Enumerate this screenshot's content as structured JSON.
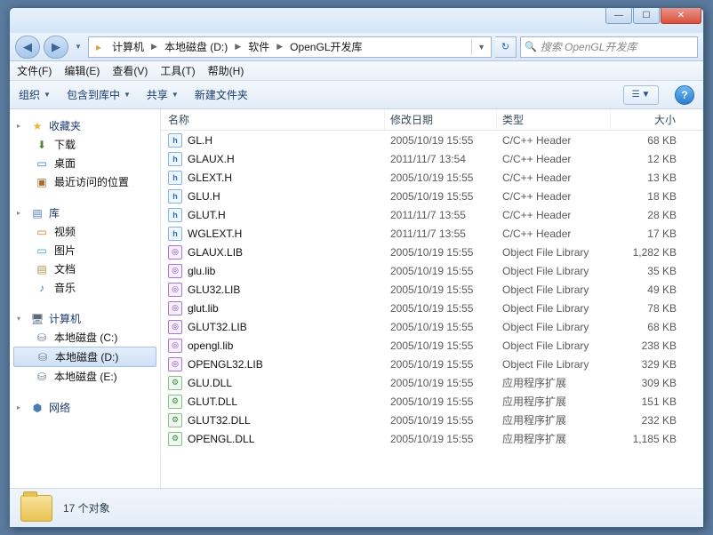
{
  "window": {
    "min": "—",
    "max": "☐",
    "close": "✕"
  },
  "nav": {
    "back": "◀",
    "fwd": "▶",
    "drop": "▼",
    "refresh": "↻",
    "icon": "📁",
    "crumbs": [
      "计算机",
      "本地磁盘 (D:)",
      "软件",
      "OpenGL开发库"
    ],
    "search_placeholder": "搜索 OpenGL开发库",
    "search_icon": "🔍"
  },
  "menu": {
    "file": "文件(F)",
    "edit": "编辑(E)",
    "view": "查看(V)",
    "tools": "工具(T)",
    "help": "帮助(H)"
  },
  "toolbar": {
    "organize": "组织",
    "include": "包含到库中",
    "share": "共享",
    "newfolder": "新建文件夹",
    "dd": "▼",
    "help": "?"
  },
  "sidebar": {
    "fav": "收藏夹",
    "fav_items": [
      "下载",
      "桌面",
      "最近访问的位置"
    ],
    "lib": "库",
    "lib_items": [
      "视频",
      "图片",
      "文档",
      "音乐"
    ],
    "comp": "计算机",
    "comp_items": [
      "本地磁盘 (C:)",
      "本地磁盘 (D:)",
      "本地磁盘 (E:)"
    ],
    "net": "网络"
  },
  "cols": {
    "name": "名称",
    "date": "修改日期",
    "type": "类型",
    "size": "大小"
  },
  "files": [
    {
      "i": "h",
      "n": "GL.H",
      "d": "2005/10/19 15:55",
      "t": "C/C++ Header",
      "s": "68 KB"
    },
    {
      "i": "h",
      "n": "GLAUX.H",
      "d": "2011/11/7 13:54",
      "t": "C/C++ Header",
      "s": "12 KB"
    },
    {
      "i": "h",
      "n": "GLEXT.H",
      "d": "2005/10/19 15:55",
      "t": "C/C++ Header",
      "s": "13 KB"
    },
    {
      "i": "h",
      "n": "GLU.H",
      "d": "2005/10/19 15:55",
      "t": "C/C++ Header",
      "s": "18 KB"
    },
    {
      "i": "h",
      "n": "GLUT.H",
      "d": "2011/11/7 13:55",
      "t": "C/C++ Header",
      "s": "28 KB"
    },
    {
      "i": "h",
      "n": "WGLEXT.H",
      "d": "2011/11/7 13:55",
      "t": "C/C++ Header",
      "s": "17 KB"
    },
    {
      "i": "lib",
      "n": "GLAUX.LIB",
      "d": "2005/10/19 15:55",
      "t": "Object File Library",
      "s": "1,282 KB"
    },
    {
      "i": "lib",
      "n": "glu.lib",
      "d": "2005/10/19 15:55",
      "t": "Object File Library",
      "s": "35 KB"
    },
    {
      "i": "lib",
      "n": "GLU32.LIB",
      "d": "2005/10/19 15:55",
      "t": "Object File Library",
      "s": "49 KB"
    },
    {
      "i": "lib",
      "n": "glut.lib",
      "d": "2005/10/19 15:55",
      "t": "Object File Library",
      "s": "78 KB"
    },
    {
      "i": "lib",
      "n": "GLUT32.LIB",
      "d": "2005/10/19 15:55",
      "t": "Object File Library",
      "s": "68 KB"
    },
    {
      "i": "lib",
      "n": "opengl.lib",
      "d": "2005/10/19 15:55",
      "t": "Object File Library",
      "s": "238 KB"
    },
    {
      "i": "lib",
      "n": "OPENGL32.LIB",
      "d": "2005/10/19 15:55",
      "t": "Object File Library",
      "s": "329 KB"
    },
    {
      "i": "dll",
      "n": "GLU.DLL",
      "d": "2005/10/19 15:55",
      "t": "应用程序扩展",
      "s": "309 KB"
    },
    {
      "i": "dll",
      "n": "GLUT.DLL",
      "d": "2005/10/19 15:55",
      "t": "应用程序扩展",
      "s": "151 KB"
    },
    {
      "i": "dll",
      "n": "GLUT32.DLL",
      "d": "2005/10/19 15:55",
      "t": "应用程序扩展",
      "s": "232 KB"
    },
    {
      "i": "dll",
      "n": "OPENGL.DLL",
      "d": "2005/10/19 15:55",
      "t": "应用程序扩展",
      "s": "1,185 KB"
    }
  ],
  "status": {
    "count": "17 个对象"
  }
}
